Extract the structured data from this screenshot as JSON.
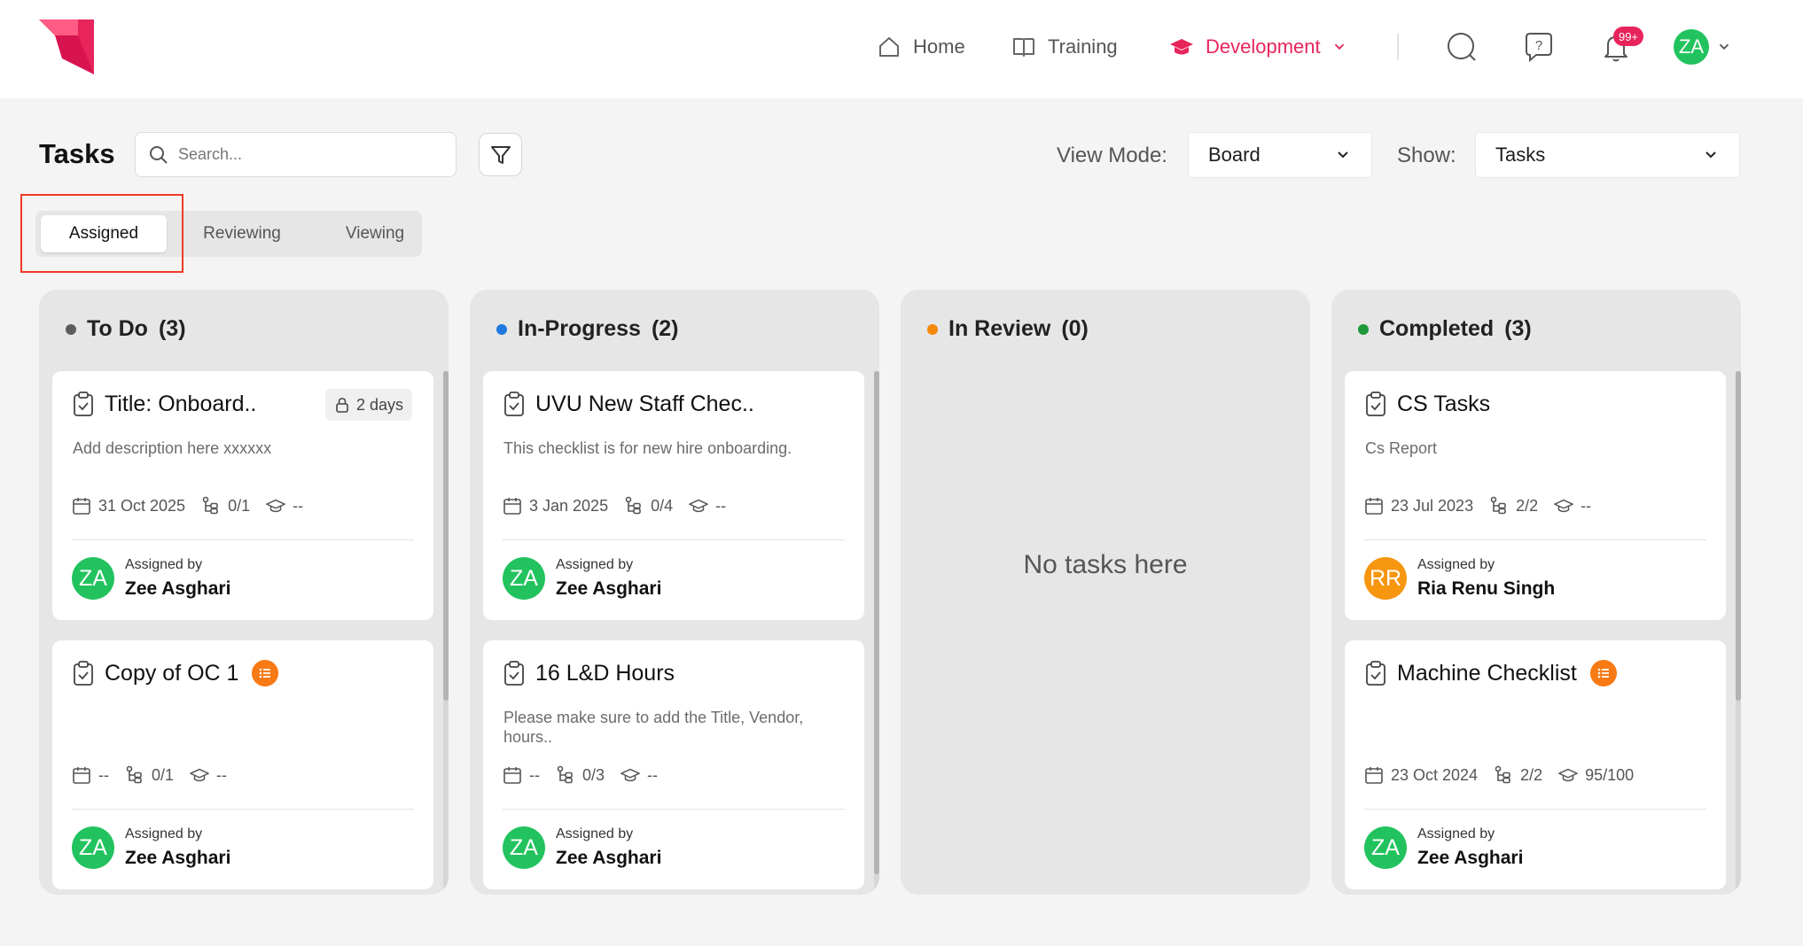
{
  "header": {
    "nav": [
      {
        "label": "Home",
        "icon": "home-icon"
      },
      {
        "label": "Training",
        "icon": "book-icon"
      },
      {
        "label": "Development",
        "icon": "graduation-cap-icon",
        "active": true
      }
    ],
    "notification_count": "99+",
    "user_initials": "ZA"
  },
  "toolbar": {
    "title": "Tasks",
    "search_placeholder": "Search...",
    "view_mode_label": "View Mode:",
    "view_mode_value": "Board",
    "show_label": "Show:",
    "show_value": "Tasks"
  },
  "tabs": [
    "Assigned",
    "Reviewing",
    "Viewing"
  ],
  "columns": [
    {
      "title": "To Do",
      "count": "(3)",
      "color": "#5d5d5d",
      "cards": [
        {
          "title": "Title: Onboard..",
          "desc": "Add description here xxxxxx",
          "date": "31 Oct 2025",
          "steps": "0/1",
          "score": "--",
          "assigned_label": "Assigned by",
          "assignee": "Zee Asghari",
          "initials": "ZA",
          "badge": "2 days"
        },
        {
          "title": "Copy of OC 1",
          "desc": "",
          "date": "--",
          "steps": "0/1",
          "score": "--",
          "assigned_label": "Assigned by",
          "assignee": "Zee Asghari",
          "initials": "ZA",
          "list_icon": true
        }
      ]
    },
    {
      "title": "In-Progress",
      "count": "(2)",
      "color": "#1f7ae0",
      "cards": [
        {
          "title": "UVU New Staff Chec..",
          "desc": "This checklist is for new hire onboarding.",
          "date": "3 Jan 2025",
          "steps": "0/4",
          "score": "--",
          "assigned_label": "Assigned by",
          "assignee": "Zee Asghari",
          "initials": "ZA"
        },
        {
          "title": "16 L&D Hours",
          "desc": "Please make sure to add the Title, Vendor, hours..",
          "date": "--",
          "steps": "0/3",
          "score": "--",
          "assigned_label": "Assigned by",
          "assignee": "Zee Asghari",
          "initials": "ZA"
        }
      ]
    },
    {
      "title": "In Review",
      "count": "(0)",
      "color": "#f5890b",
      "empty": "No tasks here"
    },
    {
      "title": "Completed",
      "count": "(3)",
      "color": "#1e9a3c",
      "cards": [
        {
          "title": "CS Tasks",
          "desc": "Cs Report",
          "date": "23 Jul 2023",
          "steps": "2/2",
          "score": "--",
          "assigned_label": "Assigned by",
          "assignee": "Ria Renu Singh",
          "initials": "RR"
        },
        {
          "title": "Machine Checklist",
          "desc": "",
          "date": "23 Oct 2024",
          "steps": "2/2",
          "score": "95/100",
          "assigned_label": "Assigned by",
          "assignee": "Zee Asghari",
          "initials": "ZA",
          "list_icon": true
        }
      ]
    }
  ],
  "colors": {
    "brand": "#e8245c",
    "avatar_green": "#22c35e",
    "avatar_orange": "#f7960f",
    "list_badge": "#f77a14"
  }
}
